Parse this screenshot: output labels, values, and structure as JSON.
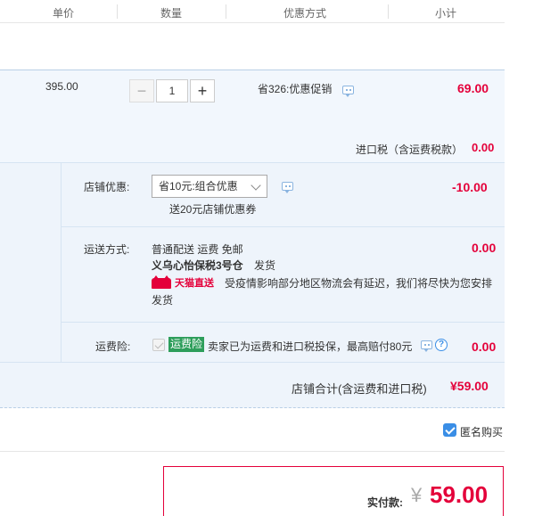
{
  "header": {
    "col_unit_price": "单价",
    "col_quantity": "数量",
    "col_discount": "优惠方式",
    "col_subtotal": "小计"
  },
  "item": {
    "unit_price": "395.00",
    "quantity": "1",
    "promo": "省326:优惠促销",
    "subtotal": "69.00",
    "tax_label": "进口税（含运费税款）",
    "tax_value": "0.00"
  },
  "store_discount": {
    "label": "店铺优惠:",
    "selected": "省10元:组合优惠",
    "coupon_note": "送20元店铺优惠券",
    "amount": "-10.00"
  },
  "shipping": {
    "label": "运送方式:",
    "method": "普通配送 运费 免邮",
    "warehouse": "义乌心怡保税3号仓",
    "dispatch": "发货",
    "badge": "天猫直送",
    "notice_line1": "受疫情影响部分地区物流会有延迟，我们将尽快为您安排",
    "notice_line2": "发货",
    "amount": "0.00"
  },
  "insurance": {
    "label": "运费险:",
    "tag": "运费险",
    "description": "卖家已为运费和进口税投保，最高赔付80元",
    "amount": "0.00"
  },
  "store_total": {
    "label": "店铺合计(含运费和进口税)",
    "amount": "¥59.00"
  },
  "anonymous": {
    "label": "匿名购买",
    "checked": true
  },
  "payment": {
    "label": "实付款:",
    "currency": "¥",
    "amount": "59.00"
  },
  "colors": {
    "accent_red": "#e4003a",
    "accent_blue": "#3a8ee6",
    "tag_green": "#2e9e5b"
  }
}
